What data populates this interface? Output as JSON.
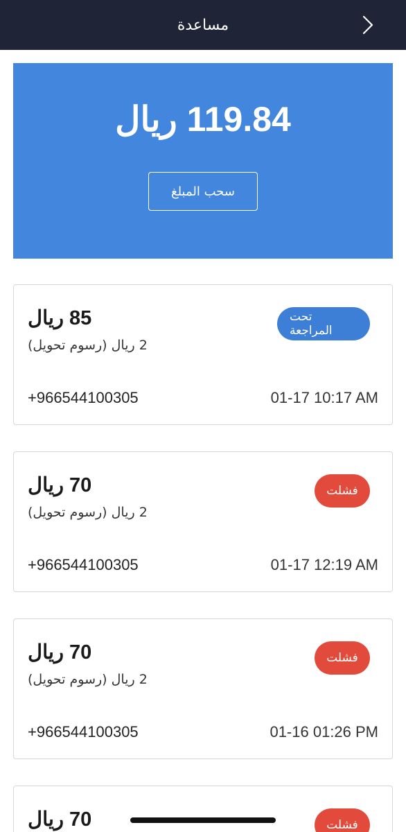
{
  "header": {
    "title": "مساعدة",
    "back_icon": "chevron-right-icon"
  },
  "balance": {
    "amount": "119.84 ريال",
    "withdraw_label": "سحب المبلغ"
  },
  "transactions": [
    {
      "amount": "85 ريال",
      "fee": "2 ريال (رسوم تحويل)",
      "status": "تحت المراجعة",
      "status_type": "review",
      "phone": "+966544100305",
      "time": "01-17 10:17 AM"
    },
    {
      "amount": "70 ريال",
      "fee": "2 ريال (رسوم تحويل)",
      "status": "فشلت",
      "status_type": "failed",
      "phone": "+966544100305",
      "time": "01-17 12:19 AM"
    },
    {
      "amount": "70 ريال",
      "fee": "2 ريال (رسوم تحويل)",
      "status": "فشلت",
      "status_type": "failed",
      "phone": "+966544100305",
      "time": "01-16 01:26 PM"
    },
    {
      "amount": "70 ريال",
      "status": "فشلت",
      "status_type": "failed"
    }
  ],
  "colors": {
    "header_bg": "#1f2536",
    "balance_bg": "#4286dd",
    "review_badge": "#3d7fd6",
    "failed_badge": "#e24b3b"
  }
}
